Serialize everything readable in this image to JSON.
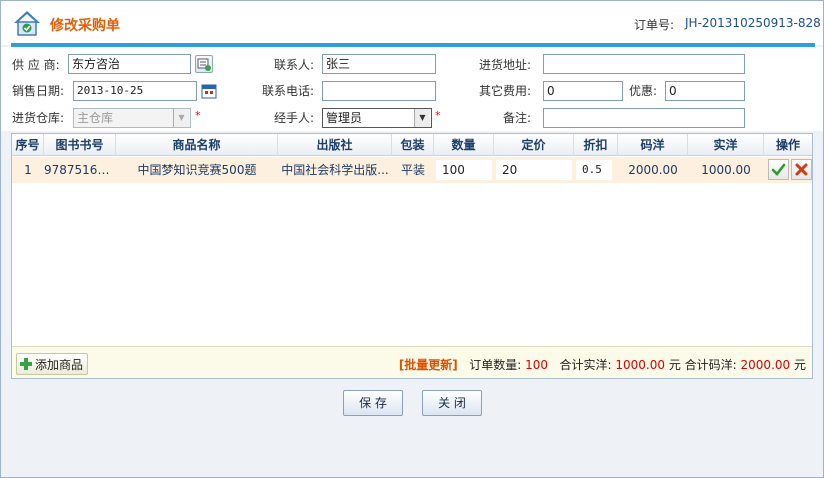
{
  "header": {
    "title": "修改采购单",
    "order_label": "订单号:",
    "order_no": "JH-201310250913-828"
  },
  "form": {
    "supplier_label": "供 应 商:",
    "supplier_value": "东方咨治",
    "contact_label": "联系人:",
    "contact_value": "张三",
    "address_label": "进货地址:",
    "address_value": "",
    "sale_date_label": "销售日期:",
    "sale_date_value": "2013-10-25",
    "phone_label": "联系电话:",
    "phone_value": "",
    "other_fee_label": "其它费用:",
    "other_fee_value": "0",
    "discount_label": "优惠:",
    "discount_value": "0",
    "warehouse_label": "进货仓库:",
    "warehouse_value": "主仓库",
    "handler_label": "经手人:",
    "handler_value": "管理员",
    "remark_label": "备注:",
    "remark_value": "",
    "required_mark": "*"
  },
  "grid": {
    "headers": [
      "序号",
      "图书书号",
      "商品名称",
      "出版社",
      "包装",
      "数量",
      "定价",
      "折扣",
      "码洋",
      "实洋",
      "操作"
    ],
    "rows": [
      {
        "no": "1",
        "isbn": "97875161...",
        "name": "中国梦知识竞赛500题",
        "publisher": "中国社会科学出版...",
        "packing": "平装",
        "qty": "100",
        "price": "20",
        "discount": "0.5",
        "list_total": "2000.00",
        "net_total": "1000.00"
      }
    ],
    "add_button": "添加商品",
    "batch_update": "[批量更新]",
    "qty_label": "订单数量:",
    "qty_value": "100",
    "net_label": "合计实洋:",
    "net_value": "1000.00",
    "net_unit": "元",
    "list_label": "合计码洋:",
    "list_value": "2000.00",
    "list_unit": "元"
  },
  "buttons": {
    "save": "保 存",
    "close": "关 闭"
  },
  "colors": {
    "accent_blue": "#2aa0dd",
    "title_orange": "#e0600a",
    "row_highlight": "#fdf0df",
    "summary_red": "#d80000"
  },
  "icons": [
    "house-logo-icon",
    "supplier-picker-icon",
    "calendar-icon",
    "plus-icon",
    "check-icon",
    "delete-icon",
    "dropdown-arrow-icon"
  ]
}
